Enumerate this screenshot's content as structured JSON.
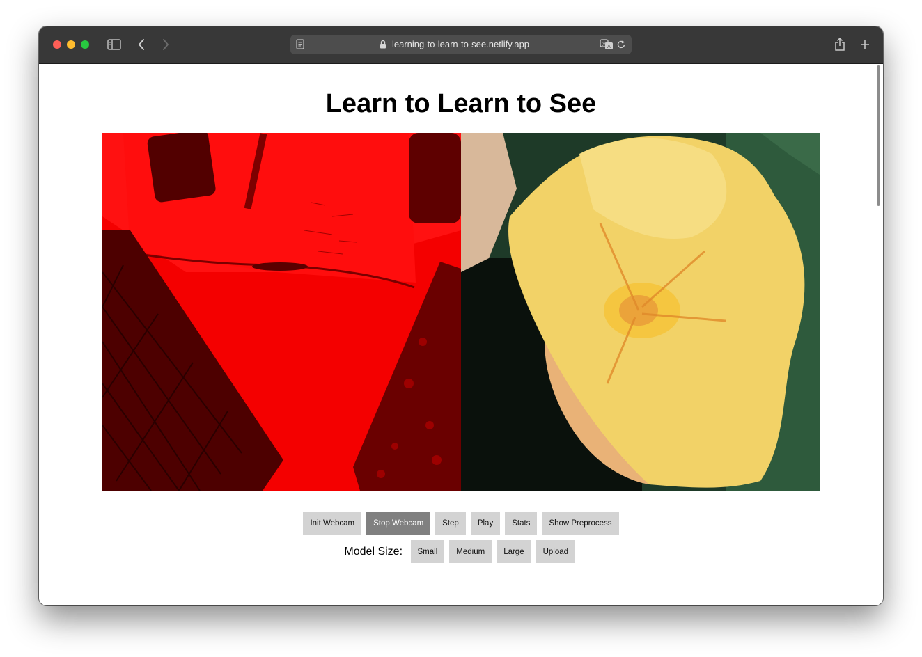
{
  "browser": {
    "url": "learning-to-learn-to-see.netlify.app",
    "icons": [
      "sidebar-icon",
      "back-icon",
      "forward-icon",
      "page-icon",
      "lock-icon",
      "translate-icon",
      "reload-icon",
      "share-icon",
      "new-tab-icon"
    ]
  },
  "page": {
    "title": "Learn to Learn to See",
    "buttons": {
      "init_webcam": "Init Webcam",
      "stop_webcam": "Stop Webcam",
      "step": "Step",
      "play": "Play",
      "stats": "Stats",
      "show_preprocess": "Show Preprocess"
    },
    "model_size_label": "Model Size:",
    "model_buttons": {
      "small": "Small",
      "medium": "Medium",
      "large": "Large",
      "upload": "Upload"
    }
  },
  "colors": {
    "active_button": "#808080",
    "button": "#d3d3d3",
    "webcam_tint": "#ff0000",
    "flower": "#f3d56a"
  }
}
